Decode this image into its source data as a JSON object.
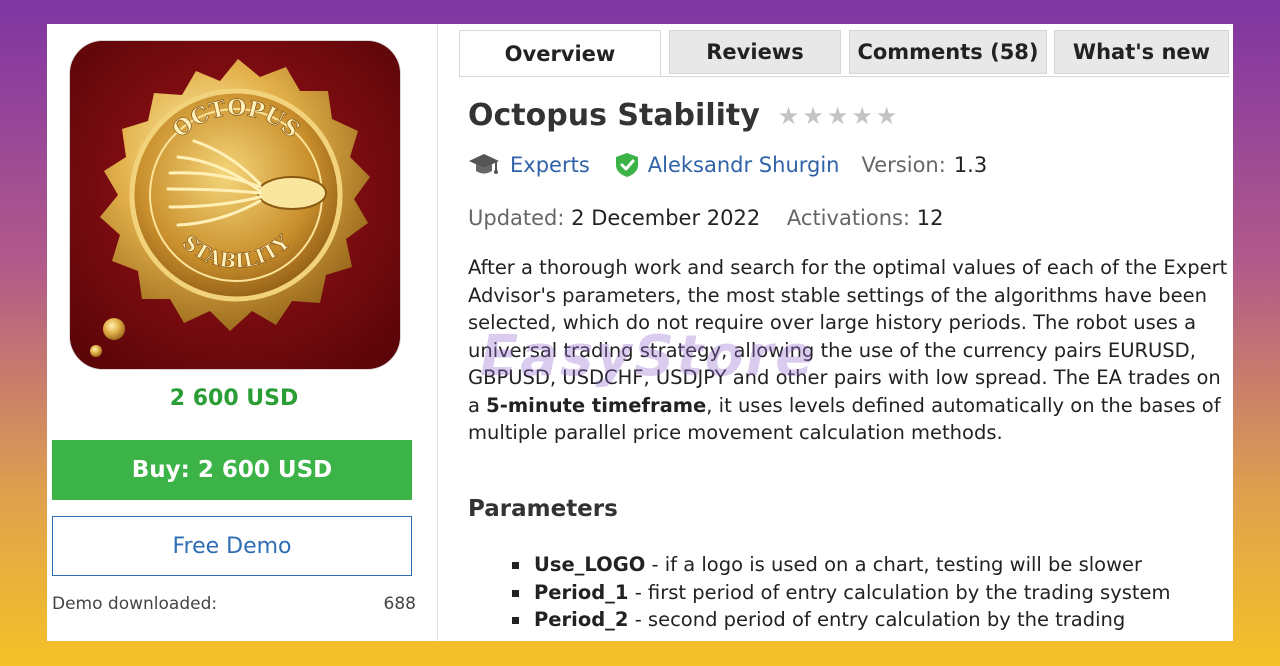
{
  "product": {
    "image_top_text": "OCTOPUS",
    "image_bottom_text": "STABILITY",
    "price": "2 600 USD",
    "buy_label": "Buy: 2 600 USD",
    "demo_label": "Free Demo",
    "demo_downloaded_label": "Demo downloaded:",
    "demo_downloaded_count": "688"
  },
  "tabs": [
    {
      "label": "Overview",
      "active": true
    },
    {
      "label": "Reviews",
      "active": false
    },
    {
      "label": "Comments (58)",
      "active": false
    },
    {
      "label": "What's new",
      "active": false
    }
  ],
  "main": {
    "title": "Octopus Stability",
    "rating_stars": 0,
    "category": "Experts",
    "author": "Aleksandr Shurgin",
    "version_label": "Version:",
    "version_value": "1.3",
    "updated_label": "Updated:",
    "updated_value": "2 December 2022",
    "activations_label": "Activations:",
    "activations_value": "12",
    "desc_part1": "After a thorough work and search for the optimal values of each of the Expert Advisor's parameters, the most stable settings of the algorithms have been selected, which do not require over large history periods. The robot uses a universal trading strategy, allowing the use of the currency pairs EURUSD, GBPUSD, USDCHF, USDJPY and other pairs with low spread. The EA trades on a ",
    "desc_bold": "5-minute timeframe",
    "desc_part2": ", it uses levels defined automatically on the bases of multiple parallel price movement calculation methods.",
    "params_heading": "Parameters",
    "params": [
      {
        "name": "Use_LOGO",
        "text": " - if a logo is used on a chart, testing will be slower"
      },
      {
        "name": "Period_1",
        "text": " - first period of entry calculation by the trading system"
      },
      {
        "name": "Period_2",
        "text": " - second period of entry calculation by the trading"
      }
    ]
  },
  "watermark": "EasyStore",
  "colors": {
    "price_green": "#2a9d34",
    "buy_green": "#3cb347",
    "link_blue": "#2f62a8"
  }
}
